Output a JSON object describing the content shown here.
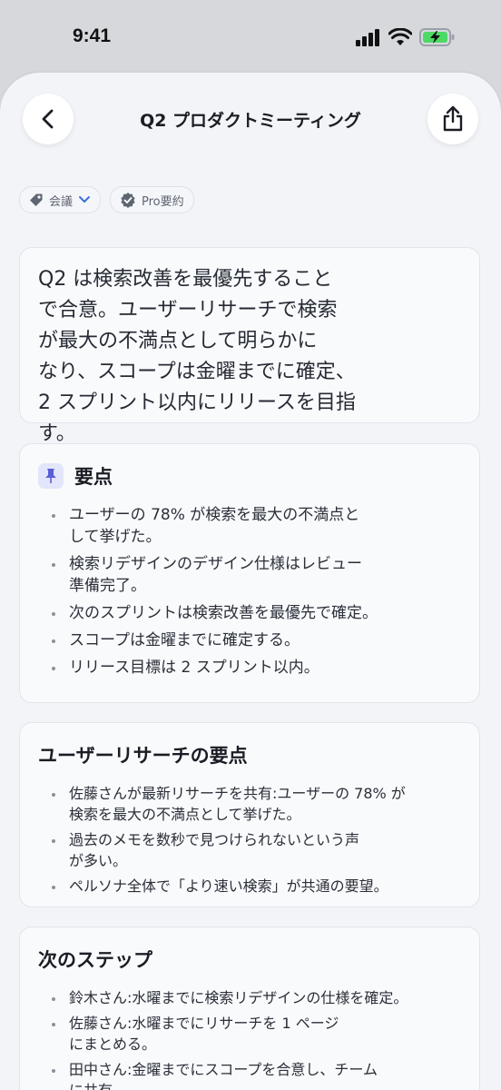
{
  "status_bar": {
    "time": "9:41"
  },
  "nav": {
    "title": "Q2 プロダクトミーティング",
    "back_icon": "chevron-left-icon",
    "share_icon": "share-icon"
  },
  "chips": [
    {
      "icon": "tag-icon",
      "label": "会議",
      "trailing_icon": "chevron-down-icon"
    },
    {
      "icon": "verified-badge-icon",
      "label": "Pro要約"
    }
  ],
  "summary": {
    "text": "Q2 は検索改善を最優先すること\nで合意。ユーザーリサーチで検索\nが最大の不満点として明らかに\nなり、スコープは金曜までに確定、\n2 スプリント以内にリリースを目指す。"
  },
  "key_points": {
    "icon": "pin-icon",
    "title": "要点",
    "items": [
      "ユーザーの 78% が検索を最大の不満点と\nして挙げた。",
      "検索リデザインのデザイン仕様はレビュー\n準備完了。",
      "次のスプリントは検索改善を最優先で確定。",
      "スコープは金曜までに確定する。",
      "リリース目標は 2 スプリント以内。"
    ]
  },
  "research": {
    "title": "ユーザーリサーチの要点",
    "items": [
      "佐藤さんが最新リサーチを共有:ユーザーの 78% が\n検索を最大の不満点として挙げた。",
      "過去のメモを数秒で見つけられないという声\nが多い。",
      "ペルソナ全体で「より速い検索」が共通の要望。"
    ]
  },
  "next_steps": {
    "title": "次のステップ",
    "items": [
      "鈴木さん:水曜までに検索リデザインの仕様を確定。",
      "佐藤さん:水曜までにリサーチを 1 ページ\nにまとめる。",
      "田中さん:金曜までにスコープを合意し、チーム\nに共有。"
    ]
  },
  "colors": {
    "accent": "#5b5fd6",
    "battery": "#4cd964",
    "background": "#f2f4f8"
  }
}
